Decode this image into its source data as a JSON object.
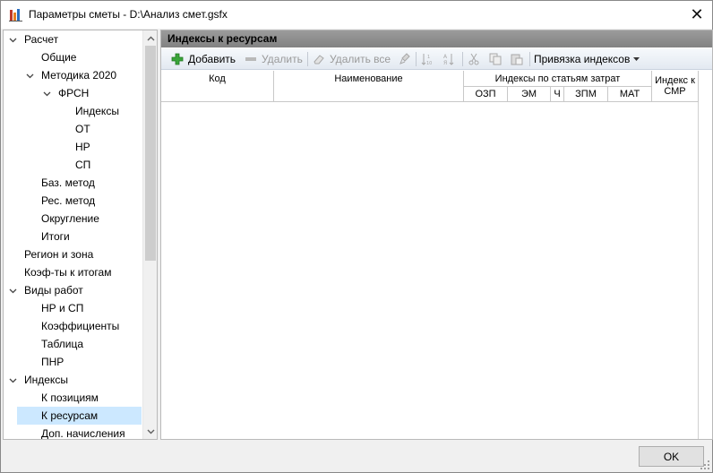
{
  "window": {
    "title": "Параметры сметы - D:\\Анализ смет.gsfx",
    "close_label": "✕"
  },
  "tree": {
    "items": [
      {
        "label": "Расчет",
        "expander": "expanded"
      },
      {
        "label": "Общие",
        "expander": "none"
      },
      {
        "label": "Методика 2020",
        "expander": "expanded"
      },
      {
        "label": "ФРСН",
        "expander": "expanded"
      },
      {
        "label": "Индексы",
        "expander": "none"
      },
      {
        "label": "ОТ",
        "expander": "none"
      },
      {
        "label": "НР",
        "expander": "none"
      },
      {
        "label": "СП",
        "expander": "none"
      },
      {
        "label": "Баз. метод",
        "expander": "none"
      },
      {
        "label": "Рес. метод",
        "expander": "none"
      },
      {
        "label": "Округление",
        "expander": "none"
      },
      {
        "label": "Итоги",
        "expander": "none"
      },
      {
        "label": "Регион и зона",
        "expander": "none"
      },
      {
        "label": "Коэф-ты к итогам",
        "expander": "none"
      },
      {
        "label": "Виды работ",
        "expander": "expanded"
      },
      {
        "label": "НР и СП",
        "expander": "none"
      },
      {
        "label": "Коэффициенты",
        "expander": "none"
      },
      {
        "label": "Таблица",
        "expander": "none"
      },
      {
        "label": "ПНР",
        "expander": "none"
      },
      {
        "label": "Индексы",
        "expander": "expanded"
      },
      {
        "label": "К позициям",
        "expander": "none"
      },
      {
        "label": "К ресурсам",
        "expander": "none",
        "selected": true
      },
      {
        "label": "Доп. начисления",
        "expander": "none"
      }
    ]
  },
  "panel": {
    "title": "Индексы к ресурсам"
  },
  "toolbar": {
    "add_label": "Добавить",
    "delete_label": "Удалить",
    "delete_all_label": "Удалить все",
    "bind_indexes_label": "Привязка индексов"
  },
  "grid": {
    "col_code": "Код",
    "col_name": "Наименование",
    "group_cost_items": "Индексы по статьям затрат",
    "col_ozp": "ОЗП",
    "col_em": "ЭМ",
    "col_ch": "Ч",
    "col_zpm": "ЗПМ",
    "col_mat": "МАТ",
    "col_smr": "Индекс к СМР"
  },
  "footer": {
    "ok_label": "OK"
  },
  "colors": {
    "selection": "#cce8ff",
    "header_bar": "#8c8c8c",
    "add_icon_green": "#2e9e2e"
  }
}
